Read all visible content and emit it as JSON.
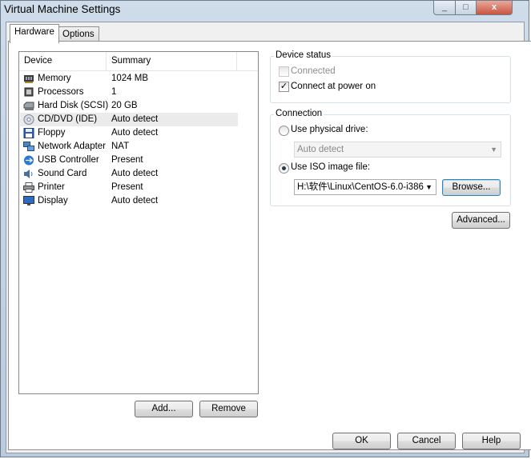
{
  "window": {
    "title": "Virtual Machine Settings",
    "close_glyph": "x",
    "min_glyph": "_",
    "max_glyph": "□"
  },
  "tabs": [
    {
      "label": "Hardware"
    },
    {
      "label": "Options"
    }
  ],
  "device_list": {
    "columns": {
      "device": "Device",
      "summary": "Summary"
    },
    "rows": [
      {
        "device": "Memory",
        "summary": "1024 MB",
        "icon": "memory-icon"
      },
      {
        "device": "Processors",
        "summary": "1",
        "icon": "processor-icon"
      },
      {
        "device": "Hard Disk (SCSI)",
        "summary": "20 GB",
        "icon": "hard-disk-icon"
      },
      {
        "device": "CD/DVD (IDE)",
        "summary": "Auto detect",
        "icon": "cd-dvd-icon"
      },
      {
        "device": "Floppy",
        "summary": "Auto detect",
        "icon": "floppy-icon"
      },
      {
        "device": "Network Adapter",
        "summary": "NAT",
        "icon": "network-icon"
      },
      {
        "device": "USB Controller",
        "summary": "Present",
        "icon": "usb-icon"
      },
      {
        "device": "Sound Card",
        "summary": "Auto detect",
        "icon": "sound-icon"
      },
      {
        "device": "Printer",
        "summary": "Present",
        "icon": "printer-icon"
      },
      {
        "device": "Display",
        "summary": "Auto detect",
        "icon": "display-icon"
      }
    ],
    "selected_index": 3
  },
  "list_buttons": {
    "add": "Add...",
    "remove": "Remove"
  },
  "device_status": {
    "title": "Device status",
    "connected": {
      "label": "Connected",
      "checked": false,
      "enabled": false
    },
    "connect_at_power_on": {
      "label": "Connect at power on",
      "checked": true
    }
  },
  "connection": {
    "title": "Connection",
    "physical": {
      "label": "Use physical drive:",
      "selected": false,
      "value": "Auto detect"
    },
    "iso": {
      "label": "Use ISO image file:",
      "selected": true,
      "value": "H:\\软件\\Linux\\CentOS-6.0-i386"
    },
    "browse": "Browse..."
  },
  "advanced": "Advanced...",
  "footer": {
    "ok": "OK",
    "cancel": "Cancel",
    "help": "Help"
  }
}
